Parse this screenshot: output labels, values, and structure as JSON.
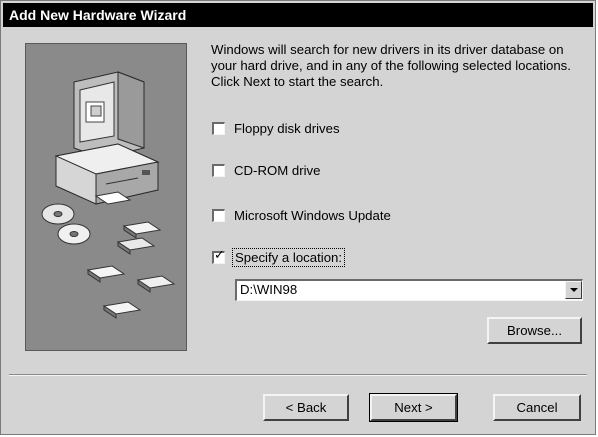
{
  "window": {
    "title": "Add New Hardware Wizard"
  },
  "instructions": "Windows will search for new drivers in its driver database on your hard drive, and in any of the following selected locations. Click Next to start the search.",
  "options": [
    {
      "label": "Floppy disk drives",
      "checked": false
    },
    {
      "label": "CD-ROM drive",
      "checked": false
    },
    {
      "label": "Microsoft Windows Update",
      "checked": false
    },
    {
      "label": "Specify a location:",
      "checked": true
    }
  ],
  "location": {
    "value": "D:\\WIN98"
  },
  "buttons": {
    "browse": "Browse...",
    "back": "< Back",
    "next": "Next >",
    "cancel": "Cancel"
  },
  "icons": {
    "dropdown": "chevron-down-icon",
    "sidebar": "computer-illustration"
  }
}
